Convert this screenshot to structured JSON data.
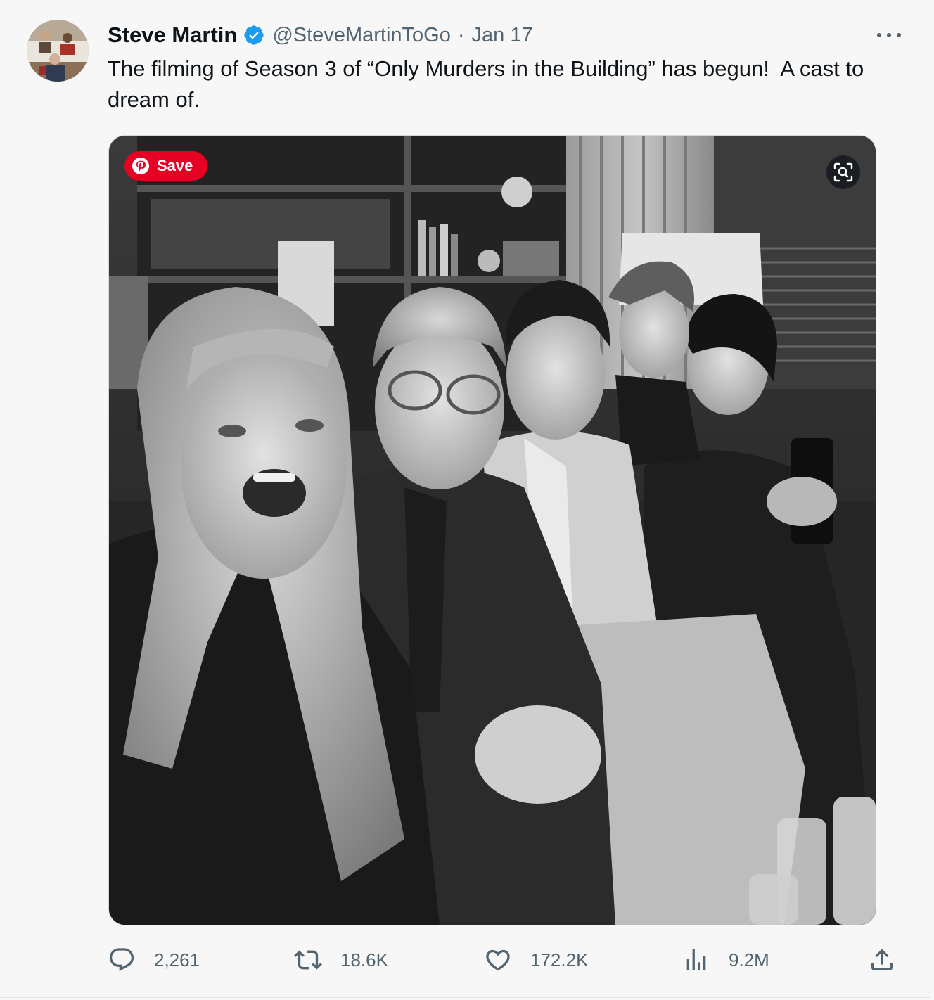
{
  "tweet": {
    "author_name": "Steve Martin",
    "handle": "@SteveMartinToGo",
    "separator": "·",
    "date": "Jan 17",
    "text": "The filming of Season 3 of “Only Murders in the Building” has begun!  A cast to dream of.",
    "verified_color": "#1d9bf0"
  },
  "media": {
    "save_label": "Save",
    "save_color": "#e60023"
  },
  "actions": {
    "replies": "2,261",
    "retweets": "18.6K",
    "likes": "172.2K",
    "views": "9.2M"
  },
  "icons": {
    "avatar": "avatar-photo",
    "verified": "verified-badge-icon",
    "more": "more-options-icon",
    "pinterest": "pinterest-icon",
    "lens": "visual-search-icon",
    "reply": "reply-icon",
    "retweet": "retweet-icon",
    "like": "heart-icon",
    "views": "views-chart-icon",
    "share": "share-icon"
  }
}
